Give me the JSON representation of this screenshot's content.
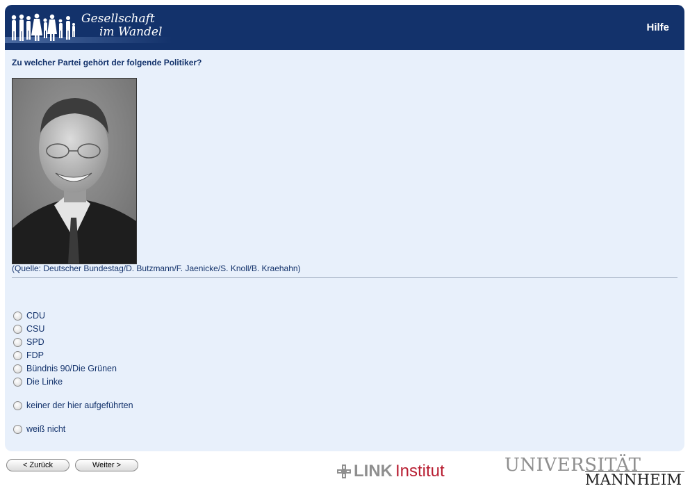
{
  "header": {
    "logo_line1": "Gesellschaft",
    "logo_line2": "im Wandel",
    "help_label": "Hilfe"
  },
  "question": {
    "text": "Zu welcher Partei gehört der folgende Politiker?",
    "photo_source": "(Quelle: Deutscher Bundestag/D. Butzmann/F. Jaenicke/S. Knoll/B. Kraehahn)"
  },
  "options": [
    {
      "label": "CDU"
    },
    {
      "label": "CSU"
    },
    {
      "label": "SPD"
    },
    {
      "label": "FDP"
    },
    {
      "label": "Bündnis 90/Die Grünen"
    },
    {
      "label": "Die Linke"
    },
    {
      "label": "keiner der hier aufgeführten"
    },
    {
      "label": "weiß nicht"
    }
  ],
  "nav": {
    "back_label": "< Zurück",
    "next_label": "Weiter >"
  },
  "footer": {
    "link_label": "LINK",
    "institut_label": "Institut",
    "uni_line1": "UNIVERSITÄT",
    "uni_line2": "MANNHEIM"
  },
  "colors": {
    "header_bg": "#13326b",
    "panel_bg": "#e8f0fb",
    "text": "#13326b",
    "link_red": "#b81e32"
  }
}
